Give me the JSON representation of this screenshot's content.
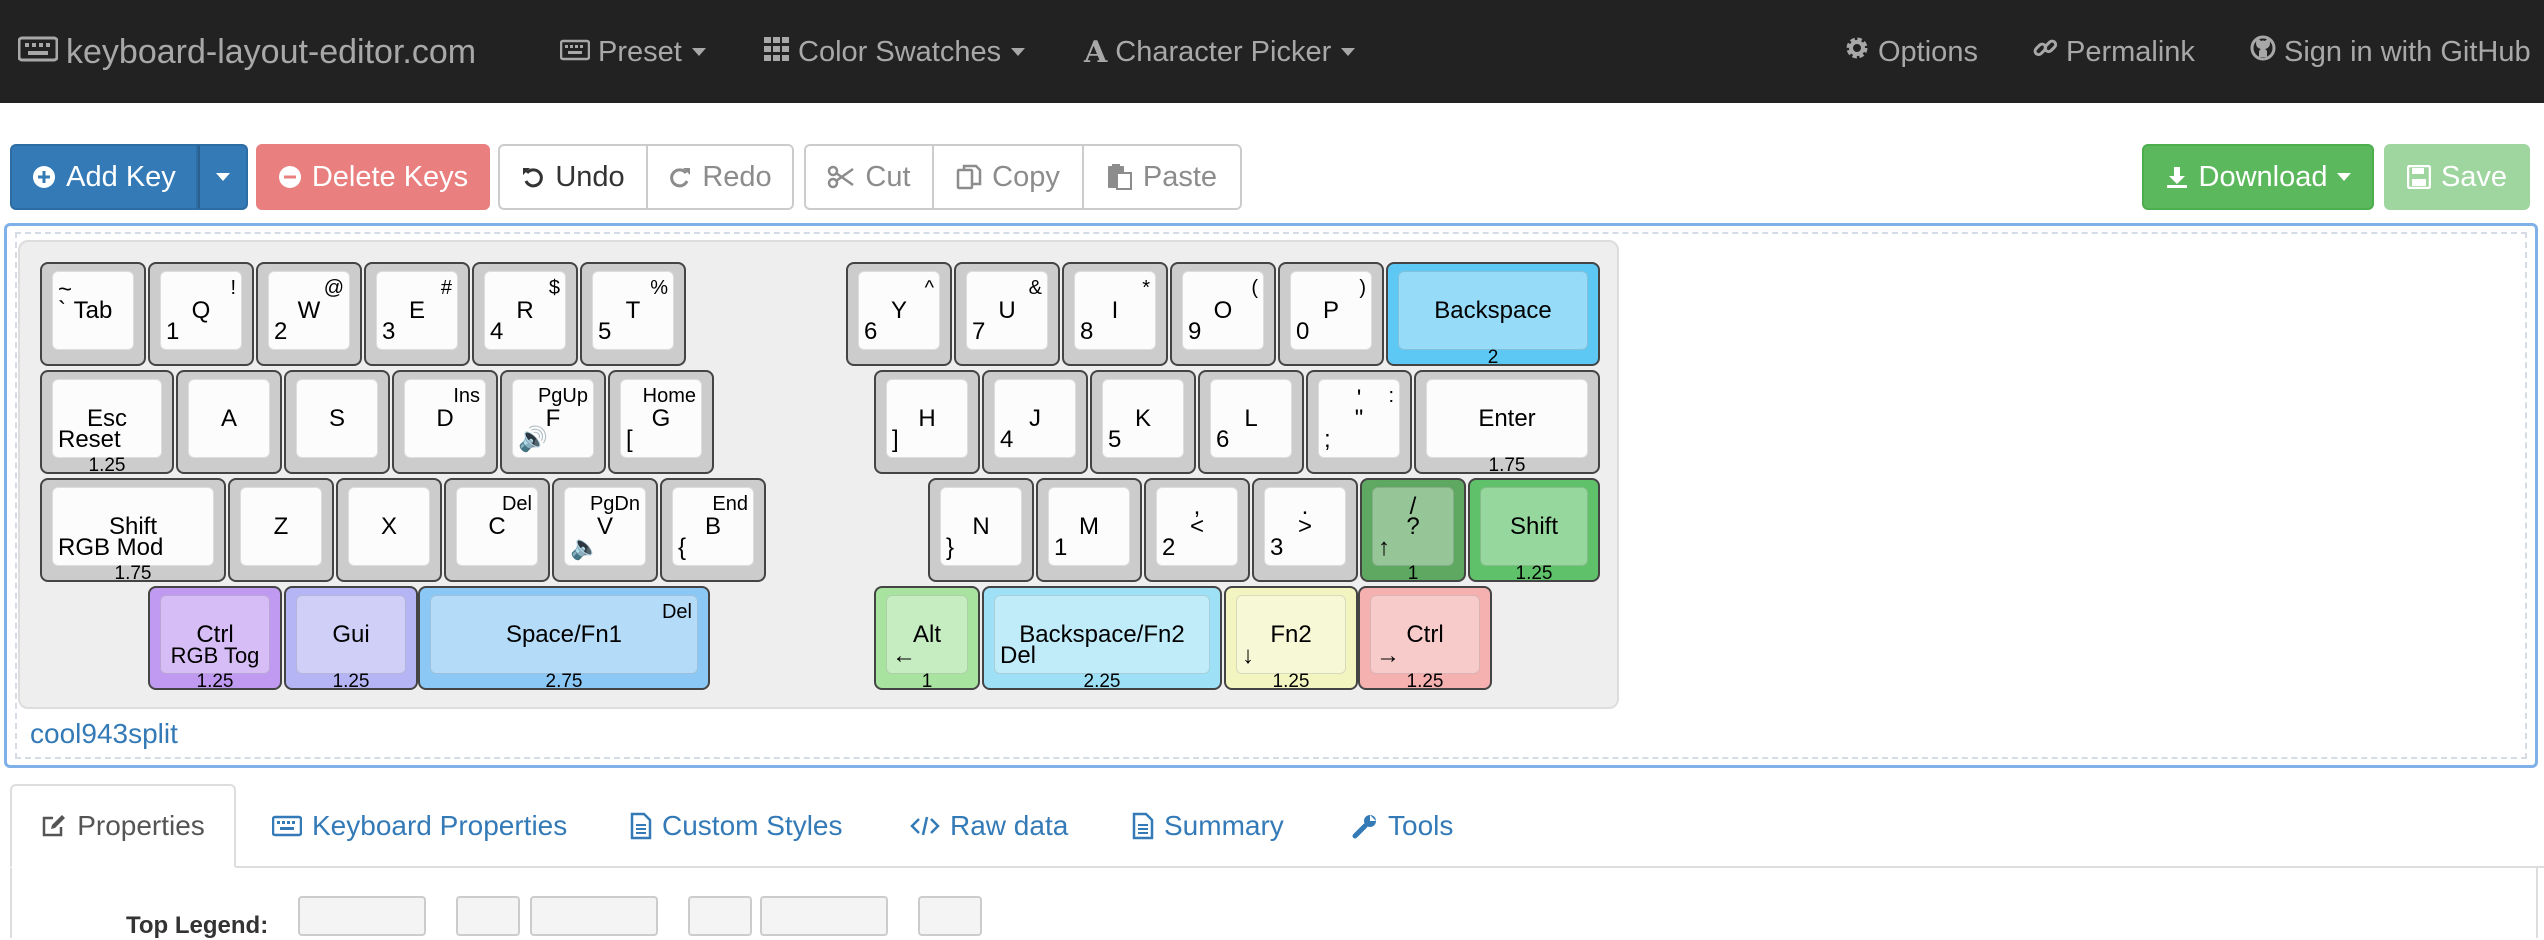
{
  "navbar": {
    "brand": "keyboard-layout-editor.com",
    "preset": "Preset",
    "color_swatches": "Color Swatches",
    "character_picker": "Character Picker",
    "options": "Options",
    "permalink": "Permalink",
    "sign_in": "Sign in with GitHub"
  },
  "toolbar": {
    "add_key": "Add Key",
    "delete_keys": "Delete Keys",
    "undo": "Undo",
    "redo": "Redo",
    "cut": "Cut",
    "copy": "Copy",
    "paste": "Paste",
    "download": "Download",
    "save": "Save"
  },
  "keyboard_name": "cool943split",
  "colors": {
    "blue_backspace": "#5ec8f5",
    "purple_ctrl": "#c09af0",
    "periwinkle_gui": "#b5b5f5",
    "blue_space": "#8cc8f5",
    "green_alt": "#a8e3a0",
    "light_blue_bksp": "#9ee0f5",
    "yellow_fn2": "#f2f5c0",
    "pink_ctrl": "#f5b0b0",
    "dark_green_slash": "#5fa862",
    "green_shift": "#5fc26a",
    "key_gray": "#cccccc"
  },
  "keys": [
    {
      "tl": "~",
      "cl": "`",
      "cc": "Tab",
      "color": "#cccccc"
    },
    {
      "tr": "!",
      "cc": "Q",
      "bl": "1",
      "color": "#cccccc"
    },
    {
      "tr": "@",
      "cc": "W",
      "bl": "2",
      "color": "#cccccc"
    },
    {
      "tr": "#",
      "cc": "E",
      "bl": "3",
      "color": "#cccccc"
    },
    {
      "tr": "$",
      "cc": "R",
      "bl": "4",
      "color": "#cccccc"
    },
    {
      "tr": "%",
      "cc": "T",
      "bl": "5",
      "color": "#cccccc"
    },
    {
      "tr": "^",
      "cc": "Y",
      "bl": "6",
      "color": "#cccccc"
    },
    {
      "tr": "&",
      "cc": "U",
      "bl": "7",
      "color": "#cccccc"
    },
    {
      "tr": "*",
      "cc": "I",
      "bl": "8",
      "color": "#cccccc"
    },
    {
      "tr": "(",
      "cc": "O",
      "bl": "9",
      "color": "#cccccc"
    },
    {
      "tr": ")",
      "cc": "P",
      "bl": "0",
      "color": "#cccccc"
    },
    {
      "cc": "Backspace",
      "fr": "2",
      "color": "#5ec8f5"
    },
    {
      "cc": "Esc",
      "bl": "Reset",
      "fr": "1.25",
      "color": "#cccccc"
    },
    {
      "cc": "A",
      "color": "#cccccc"
    },
    {
      "cc": "S",
      "color": "#cccccc"
    },
    {
      "tr": "Ins",
      "cc": "D",
      "color": "#cccccc"
    },
    {
      "tr": "PgUp",
      "cc": "F",
      "bl": "🔊",
      "color": "#cccccc"
    },
    {
      "tr": "Home",
      "cc": "G",
      "bl": "[",
      "color": "#cccccc"
    },
    {
      "cc": "H",
      "bl": "]",
      "color": "#cccccc"
    },
    {
      "cc": "J",
      "bl": "4",
      "color": "#cccccc"
    },
    {
      "cc": "K",
      "bl": "5",
      "color": "#cccccc"
    },
    {
      "cc": "L",
      "bl": "6",
      "color": "#cccccc"
    },
    {
      "tc": "'",
      "cc": "\"",
      "tr": ":",
      "bl": ";",
      "color": "#cccccc"
    },
    {
      "cc": "Enter",
      "fr": "1.75",
      "color": "#cccccc"
    },
    {
      "cc": "Shift",
      "bl": "RGB Mod",
      "fr": "1.75",
      "color": "#cccccc"
    },
    {
      "cc": "Z",
      "color": "#cccccc"
    },
    {
      "cc": "X",
      "color": "#cccccc"
    },
    {
      "tr": "Del",
      "cc": "C",
      "color": "#cccccc"
    },
    {
      "tr": "PgDn",
      "cc": "V",
      "bl": "🔈",
      "color": "#cccccc"
    },
    {
      "tr": "End",
      "cc": "B",
      "bl": "{",
      "color": "#cccccc"
    },
    {
      "cc": "N",
      "bl": "}",
      "color": "#cccccc"
    },
    {
      "cc": "M",
      "bl": "1",
      "color": "#cccccc"
    },
    {
      "tc": ",",
      "cc": "<",
      "bl": "2",
      "color": "#cccccc"
    },
    {
      "tc": ".",
      "cc": ">",
      "bl": "3",
      "color": "#cccccc"
    },
    {
      "tc": "/",
      "cc": "?",
      "bl": "↑",
      "fr": "1",
      "color": "#5fa862"
    },
    {
      "cc": "Shift",
      "fr": "1.25",
      "color": "#5fc26a"
    },
    {
      "cc": "Ctrl",
      "bc": "RGB Tog",
      "fr": "1.25",
      "color": "#c09af0"
    },
    {
      "cc": "Gui",
      "fr": "1.25",
      "color": "#b5b5f5"
    },
    {
      "cc": "Space/Fn1",
      "tr": "Del",
      "fr": "2.75",
      "color": "#8cc8f5"
    },
    {
      "cc": "Alt",
      "bl": "←",
      "fr": "1",
      "color": "#a8e3a0"
    },
    {
      "cc": "Backspace/Fn2",
      "bl": "Del",
      "fr": "2.25",
      "color": "#9ee0f5"
    },
    {
      "cc": "Fn2",
      "bl": "↓",
      "fr": "1.25",
      "color": "#f2f5c0"
    },
    {
      "cc": "Ctrl",
      "bl": "→",
      "fr": "1.25",
      "color": "#f5b0b0"
    }
  ],
  "tabs": [
    {
      "label": "Properties",
      "icon": "edit-icon"
    },
    {
      "label": "Keyboard Properties",
      "icon": "keyboard-icon"
    },
    {
      "label": "Custom Styles",
      "icon": "file-icon"
    },
    {
      "label": "Raw data",
      "icon": "code-icon"
    },
    {
      "label": "Summary",
      "icon": "file-icon"
    },
    {
      "label": "Tools",
      "icon": "wrench-icon"
    }
  ],
  "properties": {
    "top_legend_label": "Top Legend:"
  }
}
